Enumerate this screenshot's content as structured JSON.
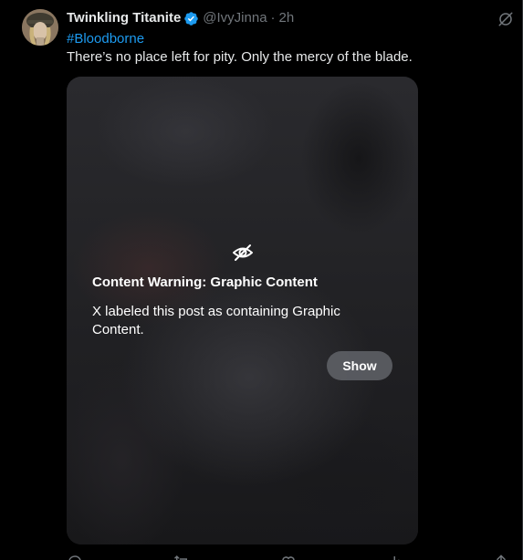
{
  "post": {
    "author": {
      "display_name": "Twinkling Titanite",
      "handle": "@IvyJinna",
      "verified": true
    },
    "separator": "·",
    "time": "2h",
    "hashtag": "#Bloodborne",
    "text": "There’s no place left for pity. Only the mercy of the blade."
  },
  "media_warning": {
    "icon": "eye-off-icon",
    "title": "Content Warning: Graphic Content",
    "description": "X labeled this post as containing Graphic Content.",
    "show_label": "Show"
  },
  "actions": [
    "reply-icon",
    "repost-icon",
    "like-icon",
    "views-icon",
    "share-icon"
  ],
  "colors": {
    "background": "#000000",
    "text": "#e7e9ea",
    "secondary": "#71767b",
    "accent": "#1d9bf0",
    "button": "#5b5d62"
  }
}
